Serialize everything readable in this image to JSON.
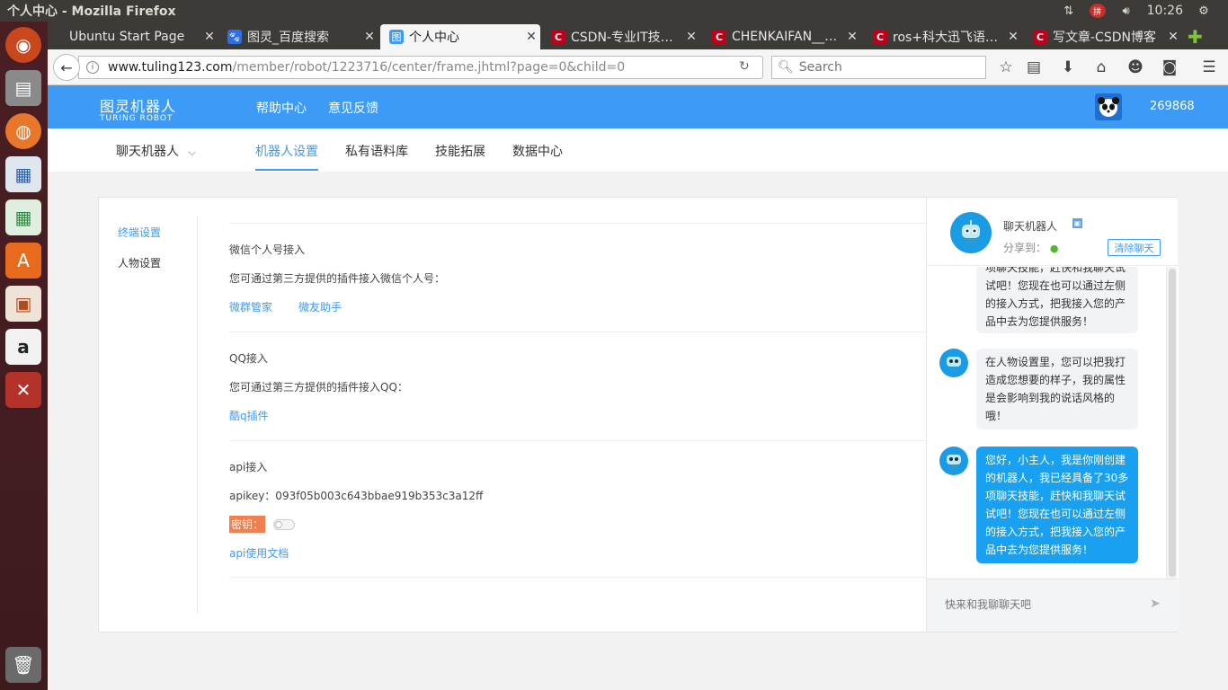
{
  "window": {
    "title": "个人中心 - Mozilla Firefox"
  },
  "tray": {
    "time": "10:26"
  },
  "tabs": [
    {
      "label": "Ubuntu Start Page"
    },
    {
      "label": "图灵_百度搜索"
    },
    {
      "label": "个人中心"
    },
    {
      "label": "CSDN-专业IT技…"
    },
    {
      "label": "CHENKAIFAN__…"
    },
    {
      "label": "ros+科大迅飞语…"
    },
    {
      "label": "写文章-CSDN博客"
    }
  ],
  "navbar": {
    "url_domain": "www.tuling123.com",
    "url_path": "/member/robot/1223716/center/frame.jhtml?page=0&child=0",
    "search_placeholder": "Search"
  },
  "header": {
    "logo_cn": "图灵机器人",
    "logo_en": "TURING ROBOT",
    "links": [
      "帮助中心",
      "意见反馈"
    ],
    "user_id": "269868"
  },
  "subnav": {
    "robot_selector": "聊天机器人",
    "tabs": [
      "机器人设置",
      "私有语料库",
      "技能拓展",
      "数据中心"
    ]
  },
  "sidebar": {
    "items": [
      "终端设置",
      "人物设置"
    ]
  },
  "content": {
    "wechat_title": "微信个人号接入",
    "wechat_desc": "您可通过第三方提供的插件接入微信个人号：",
    "wechat_links": [
      "微群管家",
      "微友助手"
    ],
    "qq_title": "QQ接入",
    "qq_desc": "您可通过第三方提供的插件接入QQ：",
    "qq_link": "酷q插件",
    "api_title": "api接入",
    "apikey": "apikey：093f05b003c643bbae919b353c3a12ff",
    "secret_label": "密钥：",
    "api_doc_link": "api使用文档"
  },
  "chat": {
    "bot_name": "聊天机器人",
    "share_label": "分享到：",
    "clear_button": "清除聊天",
    "messages": [
      "项聊天技能，赶快和我聊天试试吧！您现在也可以通过左侧的接入方式，把我接入您的产品中去为您提供服务！",
      "在人物设置里，您可以把我打造成您想要的样子，我的属性是会影响到我的说话风格的哦！",
      "您好，小主人，我是你刚创建的机器人，我已经具备了30多项聊天技能，赶快和我聊天试试吧！您现在也可以通过左侧的接入方式，把我接入您的产品中去为您提供服务！"
    ],
    "input_placeholder": "快来和我聊聊天吧"
  },
  "colors": {
    "brand": "#3d9bf5",
    "secret_label_bg": "#f08050",
    "bubble_blue": "#1aa0f0"
  }
}
